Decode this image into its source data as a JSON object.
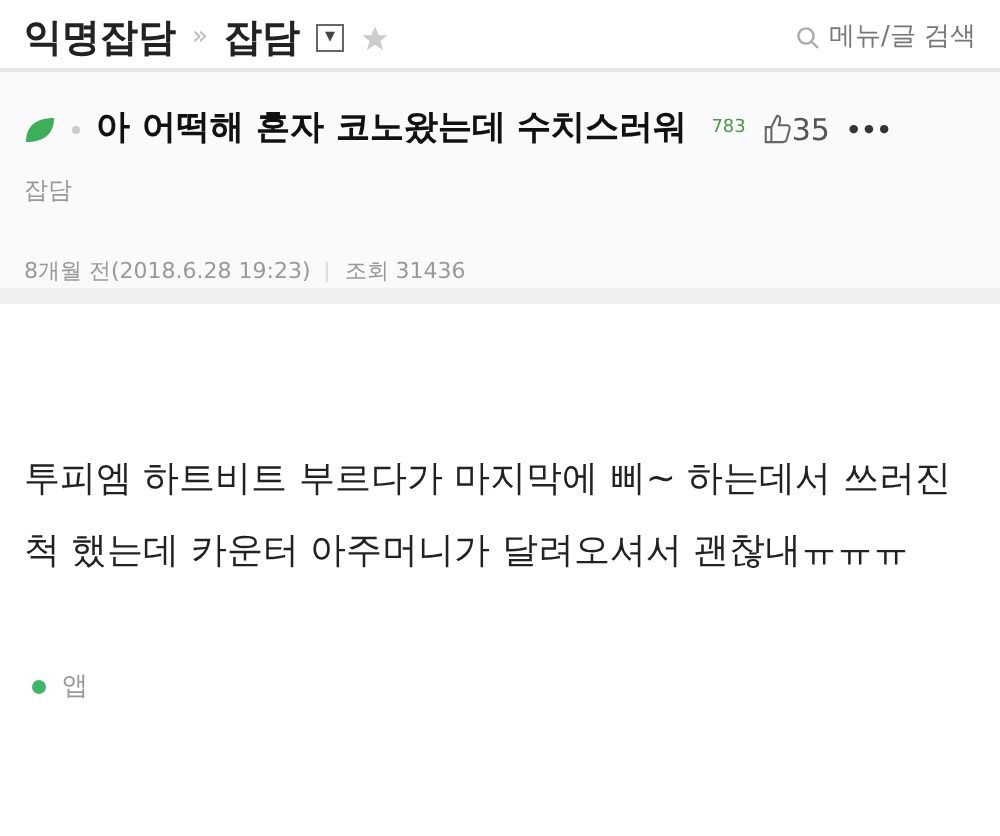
{
  "breadcrumb": {
    "board": "익명잡담",
    "separator": "»",
    "category": "잡담",
    "dropdown_icon": "▾",
    "favorited": false
  },
  "search": {
    "label": "메뉴/글 검색"
  },
  "post": {
    "title": "아 어떡해 혼자 코노왔는데 수치스러워",
    "views_badge": "783",
    "likes": "35",
    "more": "•••",
    "category": "잡담",
    "time": "8개월 전(2018.6.28 19:23)",
    "views": "조회 31436"
  },
  "body": {
    "lines": [
      "투피엠 하트비트 부르다가 마지막에 삐~ 하는데서 쓰러진",
      "척 했는데 카운터 아주머니가 달려오셔서 괜찮내ㅠㅠㅠ"
    ]
  },
  "footer": {
    "source": "앱"
  }
}
